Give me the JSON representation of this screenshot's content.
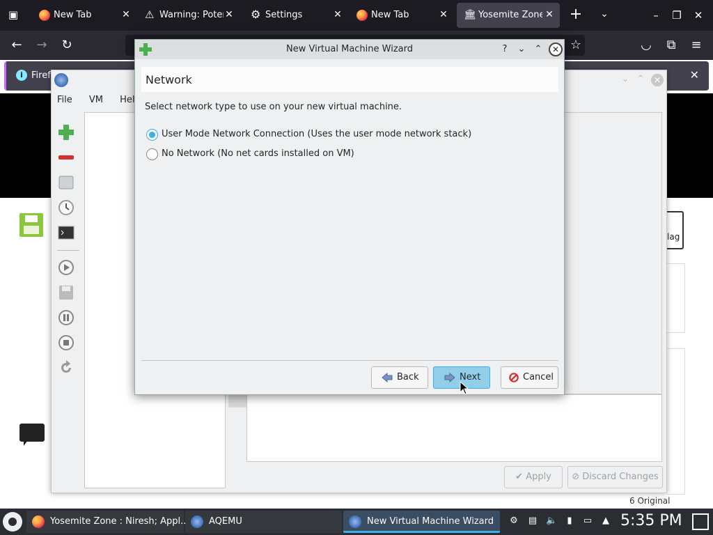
{
  "browser": {
    "tabs": [
      {
        "label": "New Tab",
        "icon": "firefox-icon"
      },
      {
        "label": "Warning: Poter",
        "icon": "warning-icon"
      },
      {
        "label": "Settings",
        "icon": "gear-icon"
      },
      {
        "label": "New Tab",
        "icon": "firefox-icon"
      },
      {
        "label": "Yosemite Zone",
        "icon": "museum-icon",
        "active": true
      }
    ],
    "new_tab_symbol": "+",
    "notification_text": "Firef"
  },
  "webpage": {
    "flag_label": "lag",
    "footer_text": "6 Original"
  },
  "aqemu": {
    "menu": [
      "File",
      "VM",
      "Help"
    ],
    "apply_label": "Apply",
    "discard_label": "Discard Changes"
  },
  "wizard": {
    "title": "New Virtual Machine Wizard",
    "header": "Network",
    "description": "Select network type to use on your new virtual machine.",
    "options": [
      {
        "label": "User Mode Network Connection (Uses the user mode network stack)",
        "checked": true
      },
      {
        "label": "No Network (No net cards installed on VM)",
        "checked": false
      }
    ],
    "help_symbol": "?",
    "buttons": {
      "back": "Back",
      "next": "Next",
      "cancel": "Cancel"
    }
  },
  "taskbar": {
    "tasks": [
      {
        "label": "Yosemite Zone : Niresh; Appl...",
        "icon": "firefox-icon"
      },
      {
        "label": "AQEMU",
        "icon": "aqemu-icon"
      },
      {
        "label": "New Virtual Machine Wizard",
        "icon": "aqemu-icon",
        "active": true
      }
    ],
    "clock": "5:35 PM"
  },
  "colors": {
    "accent": "#3daee9",
    "taskbar_bg": "#2a2e32",
    "firefox_dark": "#1c1b22"
  }
}
